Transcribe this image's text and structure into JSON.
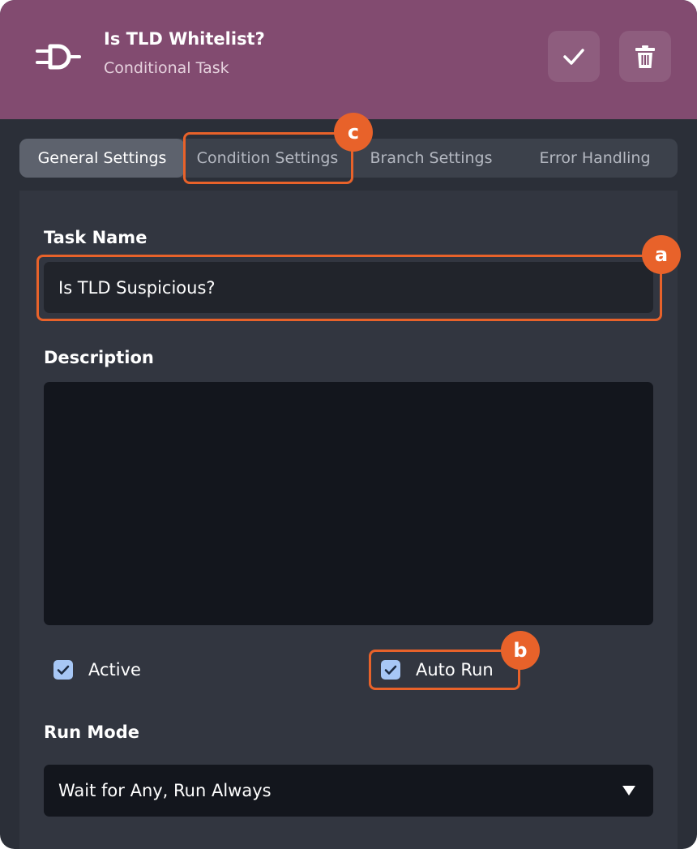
{
  "header": {
    "title": "Is TLD Whitelist?",
    "subtitle": "Conditional Task",
    "task_icon": "conditional-plug-icon",
    "confirm_icon": "check-icon",
    "delete_icon": "trash-icon"
  },
  "tabs": [
    {
      "label": "General Settings",
      "active": true
    },
    {
      "label": "Condition Settings",
      "active": false
    },
    {
      "label": "Branch Settings",
      "active": false
    },
    {
      "label": "Error Handling",
      "active": false
    }
  ],
  "form": {
    "task_name_label": "Task Name",
    "task_name_value": "Is TLD Suspicious?",
    "description_label": "Description",
    "description_value": "",
    "active_label": "Active",
    "active_checked": true,
    "auto_run_label": "Auto Run",
    "auto_run_checked": true,
    "run_mode_label": "Run Mode",
    "run_mode_value": "Wait for Any, Run Always"
  },
  "callouts": [
    "a",
    "b",
    "c"
  ],
  "colors": {
    "header": "#824b70",
    "panel": "#2b2f38",
    "accent_callout": "#e8622a",
    "checkbox": "#a7c7f5"
  }
}
